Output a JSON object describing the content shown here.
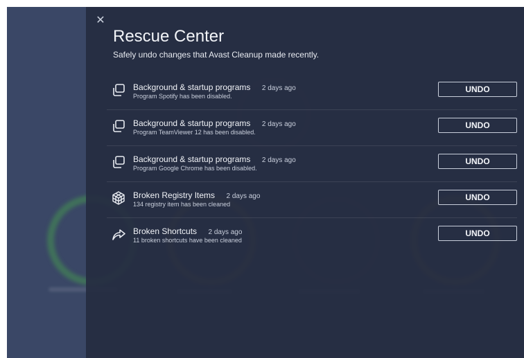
{
  "panel": {
    "close_icon": "close-icon",
    "title": "Rescue Center",
    "subtitle": "Safely undo changes that Avast Cleanup made recently."
  },
  "changes": [
    {
      "icon": "copy-windows-icon",
      "title": "Background & startup programs",
      "time": "2 days ago",
      "detail": "Program Spotify has been disabled.",
      "action": "UNDO"
    },
    {
      "icon": "copy-windows-icon",
      "title": "Background & startup programs",
      "time": "2 days ago",
      "detail": "Program TeamViewer 12 has been disabled.",
      "action": "UNDO"
    },
    {
      "icon": "copy-windows-icon",
      "title": "Background & startup programs",
      "time": "2 days ago",
      "detail": "Program Google Chrome has been disabled.",
      "action": "UNDO"
    },
    {
      "icon": "registry-cube-icon",
      "title": "Broken Registry Items",
      "time": "2 days ago",
      "detail": "134 registry item has been cleaned",
      "action": "UNDO"
    },
    {
      "icon": "shortcut-arrow-icon",
      "title": "Broken Shortcuts",
      "time": "2 days ago",
      "detail": "11 broken shortcuts have been cleaned",
      "action": "UNDO"
    }
  ],
  "colors": {
    "background": "#2f3a57",
    "panel": "#262d42",
    "text": "#f2f4f8",
    "muted_text": "#c9cfdc"
  }
}
